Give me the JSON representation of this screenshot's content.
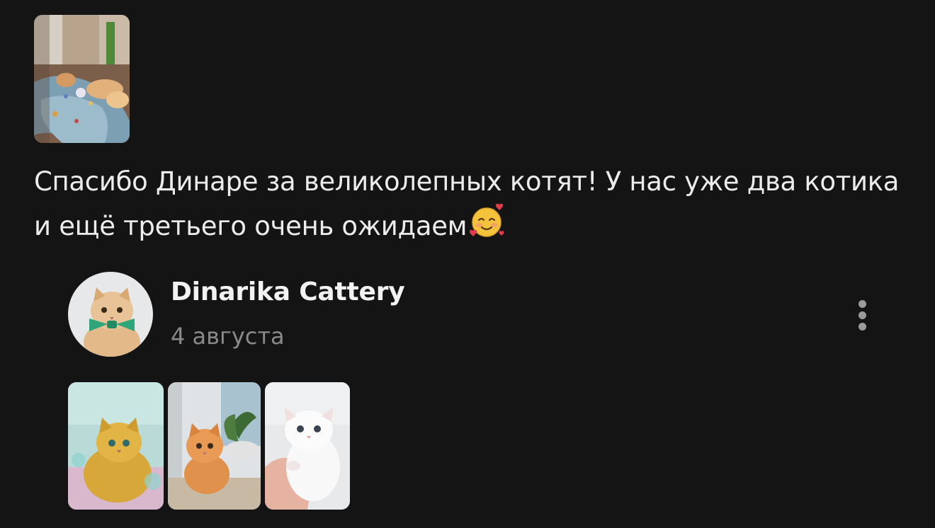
{
  "review": {
    "text": "Спасибо Динаре за  великолепных котят! У нас уже два котика и ещё третьего очень ожидаем",
    "emoji_icon": "smiling-face-with-hearts-icon",
    "photo_icon": "kittens-on-blanket-photo"
  },
  "author": {
    "name": "Dinarika Cattery",
    "date": "4 августа",
    "avatar_icon": "kitten-with-bowtie-avatar"
  },
  "menu": {
    "icon": "vertical-ellipsis-icon"
  },
  "thumbnails": [
    {
      "icon": "golden-fluffy-kitten-photo"
    },
    {
      "icon": "ginger-kitten-near-plant-photo"
    },
    {
      "icon": "white-kitten-in-hand-photo"
    }
  ],
  "colors": {
    "background": "#141414",
    "text": "#ececec",
    "secondary_text": "#8a8a8a",
    "menu_dots": "#9b9b9b"
  }
}
